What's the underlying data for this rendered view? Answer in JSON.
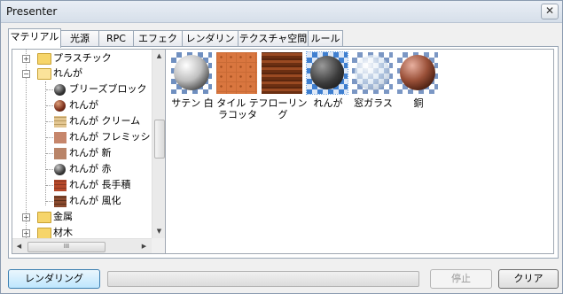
{
  "window": {
    "title": "Presenter",
    "close_glyph": "✕"
  },
  "tabs": [
    {
      "label": "マテリアル",
      "active": true
    },
    {
      "label": "光源"
    },
    {
      "label": "RPC"
    },
    {
      "label": "エフェクト"
    },
    {
      "label": "レンダリング"
    },
    {
      "label": "テクスチャ空間"
    },
    {
      "label": "ルール"
    }
  ],
  "tree": {
    "items": [
      {
        "label": "プラスチック",
        "icon": "folder-icon",
        "expander": "+"
      },
      {
        "label": "れんが",
        "icon": "folder-open-icon",
        "expander": "−"
      },
      {
        "label": "ブリーズブロック",
        "icon": "sphere-dark-icon"
      },
      {
        "label": "れんが",
        "icon": "sphere-brick-icon"
      },
      {
        "label": "れんが クリーム",
        "icon": "swatch-cream-icon"
      },
      {
        "label": "れんが フレミッシュ",
        "icon": "swatch-flemish-icon"
      },
      {
        "label": "れんが 新",
        "icon": "swatch-new-icon"
      },
      {
        "label": "れんが 赤",
        "icon": "sphere-red-icon"
      },
      {
        "label": "れんが 長手積",
        "icon": "swatch-stretcher-icon"
      },
      {
        "label": "れんが 風化",
        "icon": "swatch-weathered-icon"
      },
      {
        "label": "金属",
        "icon": "folder-icon",
        "expander": "+"
      },
      {
        "label": "材木",
        "icon": "folder-icon",
        "expander": "+"
      }
    ],
    "hscroll_thumb_glyph": "III"
  },
  "materials": [
    {
      "label": "サテン 白",
      "icon": "satin-white-sphere-icon"
    },
    {
      "label": "タイル テラコッタ",
      "icon": "terracotta-tile-icon"
    },
    {
      "label": "フローリング",
      "icon": "flooring-icon"
    },
    {
      "label": "れんが",
      "icon": "brick-sphere-icon",
      "selected": true
    },
    {
      "label": "窓ガラス",
      "icon": "glass-sphere-icon"
    },
    {
      "label": "銅",
      "icon": "copper-sphere-icon"
    }
  ],
  "buttons": {
    "render": "レンダリング",
    "stop": "停止",
    "clear": "クリア"
  },
  "colors": {
    "accent": "#3c7fb1",
    "tab_border": "#9aa7b6"
  }
}
